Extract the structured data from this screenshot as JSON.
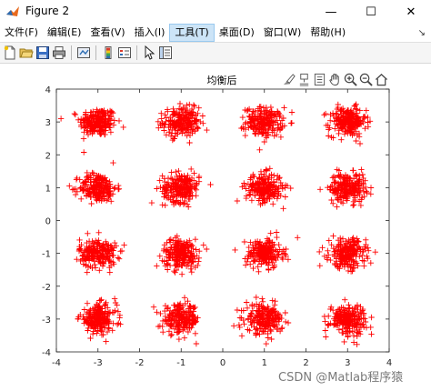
{
  "window": {
    "title": "Figure 2",
    "controls": {
      "minimize": "—",
      "maximize": "☐",
      "close": "✕"
    }
  },
  "menu": {
    "items": [
      "文件(F)",
      "编辑(E)",
      "查看(V)",
      "插入(I)",
      "工具(T)",
      "桌面(D)",
      "窗口(W)",
      "帮助(H)"
    ],
    "active_index": 4
  },
  "toolbar": {
    "buttons": [
      "new-figure-icon",
      "open-file-icon",
      "save-icon",
      "print-icon",
      "link-plot-icon",
      "insert-colorbar-icon",
      "insert-legend-icon",
      "edit-plot-icon",
      "property-inspector-icon"
    ]
  },
  "axes_toolbar": {
    "buttons": [
      "brush-icon",
      "data-tips-icon",
      "export-icon",
      "pan-icon",
      "zoom-in-icon",
      "zoom-out-icon",
      "restore-view-icon"
    ]
  },
  "chart_data": {
    "type": "scatter",
    "title": "均衡后",
    "xlabel": "",
    "ylabel": "",
    "xlim": [
      -4,
      4
    ],
    "ylim": [
      -4,
      4
    ],
    "xticks": [
      "-4",
      "-3",
      "-2",
      "-1",
      "0",
      "1",
      "2",
      "3",
      "4"
    ],
    "yticks": [
      "-4",
      "-3",
      "-2",
      "-1",
      "0",
      "1",
      "2",
      "3",
      "4"
    ],
    "grid": false,
    "marker": "+",
    "color": "#ff0000",
    "series": [
      {
        "cluster_centers": [
          [
            -3,
            3
          ],
          [
            -1,
            3
          ],
          [
            1,
            3
          ],
          [
            3,
            3
          ],
          [
            -3,
            1
          ],
          [
            -1,
            1
          ],
          [
            1,
            1
          ],
          [
            3,
            1
          ],
          [
            -3,
            -1
          ],
          [
            -1,
            -1
          ],
          [
            1,
            -1
          ],
          [
            3,
            -1
          ],
          [
            -3,
            -3
          ],
          [
            -1,
            -3
          ],
          [
            1,
            -3
          ],
          [
            3,
            -3
          ]
        ],
        "spread_std": 0.22,
        "points_per_cluster": 220
      }
    ]
  },
  "watermark": "CSDN @Matlab程序猿"
}
